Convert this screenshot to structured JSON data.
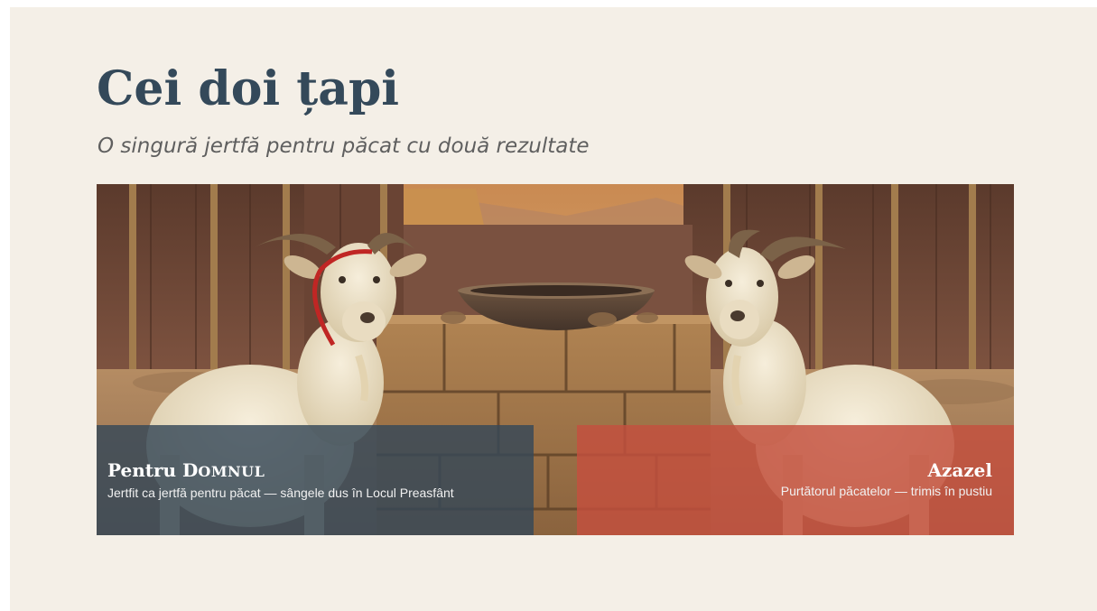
{
  "slide": {
    "title": "Cei doi țapi",
    "subtitle": "O singură jertfă pentru păcat cu două rezultate"
  },
  "illustration": {
    "subject": "two white goats beside a stone altar with a bronze basin in front of tent curtains",
    "colors": {
      "sky": "#d49a5c",
      "tent": "#6e4636",
      "ground": "#a98563",
      "stone": "#a07648",
      "goat": "#ece1c8",
      "horn": "#7b6248",
      "cord": "#c02624"
    }
  },
  "captions": {
    "left": {
      "title_prefix": "Pentru D",
      "title_smallcaps": "OMNUL",
      "text": "Jertfit ca jertfă pentru păcat — sângele dus în Locul Preasfânt",
      "color": "#364858"
    },
    "right": {
      "title": "Azazel",
      "text": "Purtătorul păcatelor — trimis în pustiu",
      "color": "#c44f3e"
    }
  }
}
